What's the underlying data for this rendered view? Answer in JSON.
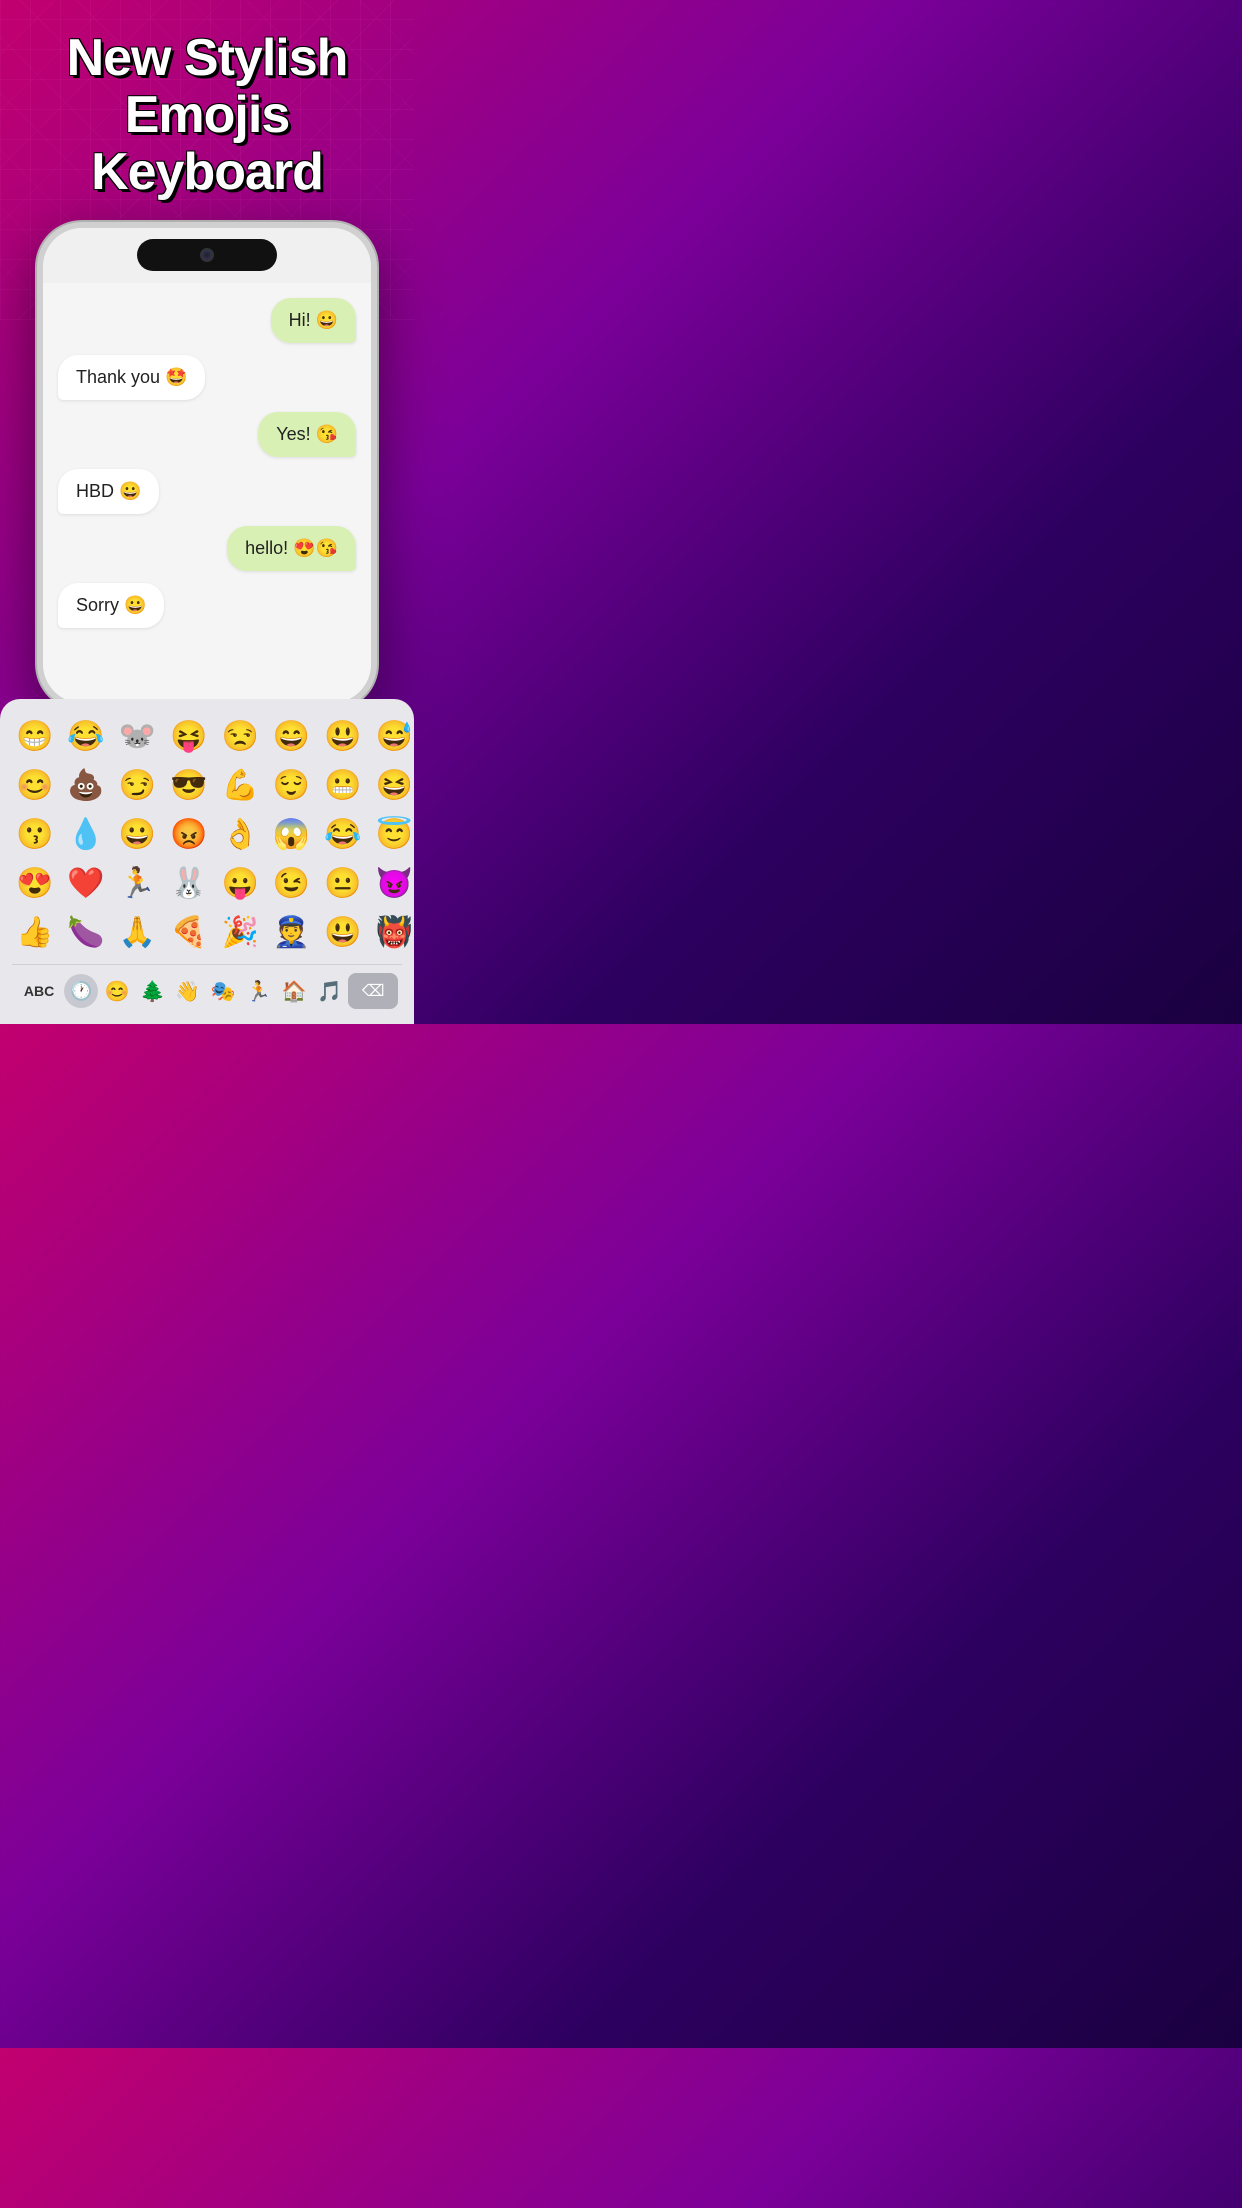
{
  "header": {
    "title_line1": "New Stylish",
    "title_line2": "Emojis Keyboard"
  },
  "phone": {
    "messages": [
      {
        "id": "msg1",
        "type": "sent",
        "text": "Hi! 😀"
      },
      {
        "id": "msg2",
        "type": "received",
        "text": "Thank you 🤩"
      },
      {
        "id": "msg3",
        "type": "sent",
        "text": "Yes! 😘"
      },
      {
        "id": "msg4",
        "type": "received",
        "text": "HBD 😀"
      },
      {
        "id": "msg5",
        "type": "sent",
        "text": "hello! 😍😘"
      },
      {
        "id": "msg6",
        "type": "received",
        "text": "Sorry 😀"
      }
    ]
  },
  "keyboard": {
    "emojis": [
      "😁",
      "😂",
      "🐭",
      "😝",
      "😒",
      "😄",
      "😃",
      "😅",
      "😊",
      "💩",
      "😏",
      "😎",
      "💪",
      "😌",
      "😬",
      "😆",
      "😗",
      "💧",
      "😀",
      "😡",
      "👌",
      "😱",
      "😂",
      "😇",
      "😍",
      "❤️",
      "🏃",
      "🐰",
      "😛",
      "😉",
      "😐",
      "😈",
      "👍",
      "🍆",
      "🙏",
      "🍕",
      "🎉",
      "👮",
      "😃",
      "👹"
    ],
    "toolbar": {
      "abc_label": "ABC",
      "buttons": [
        "🕐",
        "😊",
        "🌲",
        "👋",
        "🎭",
        "🏃",
        "🏠",
        "🎵"
      ]
    }
  }
}
